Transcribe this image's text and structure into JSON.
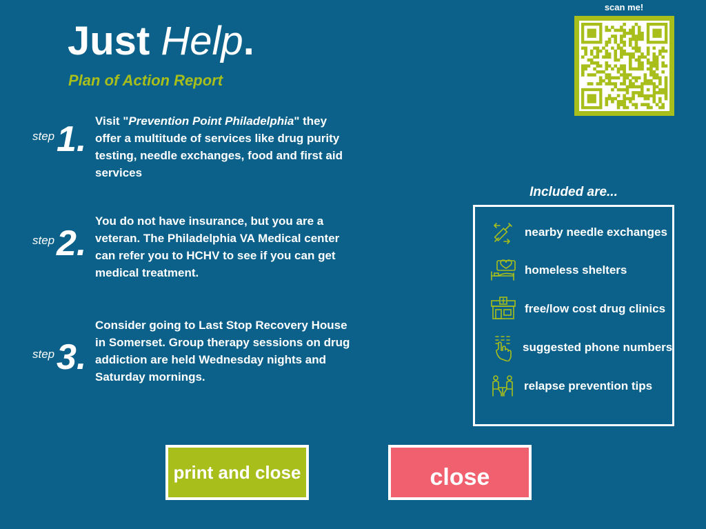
{
  "header": {
    "title_bold": "Just",
    "title_italic": "Help",
    "title_dot": ".",
    "subtitle": "Plan of Action Report"
  },
  "qr": {
    "label": "scan me!"
  },
  "steps": [
    {
      "label": "step",
      "number": "1.",
      "text_prefix": "Visit \"",
      "text_emphasis": "Prevention Point Philadelphia",
      "text_suffix": "\" they offer a multitude of services like drug purity testing, needle exchanges, food and first aid services"
    },
    {
      "label": "step",
      "number": "2.",
      "text": "You do not have insurance, but you are a veteran. The Philadelphia VA Medical center can refer you to HCHV to see if you can get medical treatment."
    },
    {
      "label": "step",
      "number": "3.",
      "text": "Consider going to Last Stop Recovery House in Somerset. Group therapy sessions on drug addiction are held Wednesday nights and Saturday mornings."
    }
  ],
  "included": {
    "label": "Included are...",
    "items": [
      {
        "icon": "syringe-icon",
        "text": "nearby needle exchanges"
      },
      {
        "icon": "bed-shelter-icon",
        "text": "homeless shelters"
      },
      {
        "icon": "clinic-icon",
        "text": "free/low cost drug clinics"
      },
      {
        "icon": "phone-dial-icon",
        "text": "suggested phone numbers"
      },
      {
        "icon": "group-support-icon",
        "text": "relapse prevention tips"
      }
    ]
  },
  "buttons": {
    "print_close": "print and close",
    "close": "close"
  },
  "colors": {
    "background": "#0b618a",
    "accent_green": "#a8be1a",
    "close_red": "#f0606e",
    "text": "#ffffff"
  }
}
